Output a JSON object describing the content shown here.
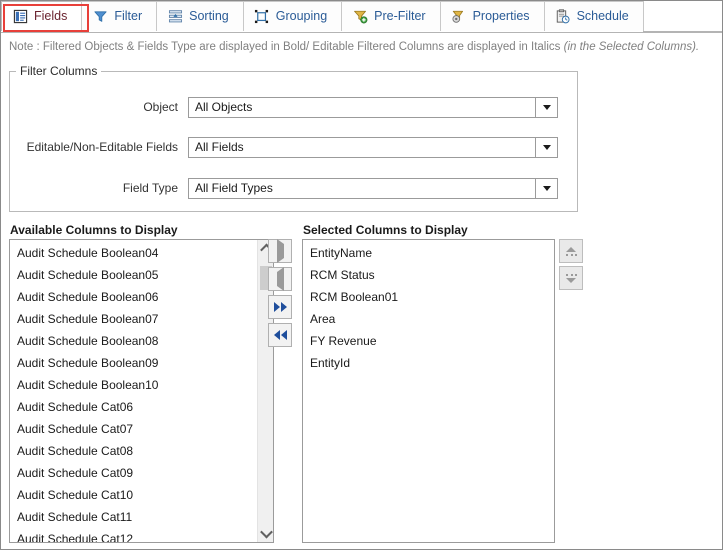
{
  "tabs": [
    {
      "label": "Fields",
      "icon": "fields-icon",
      "active": true
    },
    {
      "label": "Filter",
      "icon": "filter-icon",
      "active": false
    },
    {
      "label": "Sorting",
      "icon": "sorting-icon",
      "active": false
    },
    {
      "label": "Grouping",
      "icon": "grouping-icon",
      "active": false
    },
    {
      "label": "Pre-Filter",
      "icon": "pre-filter-icon",
      "active": false
    },
    {
      "label": "Properties",
      "icon": "properties-icon",
      "active": false
    },
    {
      "label": "Schedule",
      "icon": "schedule-icon",
      "active": false
    }
  ],
  "note": {
    "text": "Note : Filtered Objects & Fields Type are displayed in Bold/ Editable Filtered Columns are displayed in Italics ",
    "italic_text": "(in the Selected Columns)."
  },
  "filter_columns": {
    "title": "Filter Columns",
    "rows": [
      {
        "label": "Object",
        "value": "All Objects"
      },
      {
        "label": "Editable/Non-Editable Fields",
        "value": "All Fields"
      },
      {
        "label": "Field Type",
        "value": "All Field Types"
      }
    ]
  },
  "available": {
    "heading": "Available Columns to Display",
    "items": [
      "Audit Schedule Boolean04",
      "Audit Schedule Boolean05",
      "Audit Schedule Boolean06",
      "Audit Schedule Boolean07",
      "Audit Schedule Boolean08",
      "Audit Schedule Boolean09",
      "Audit Schedule Boolean10",
      "Audit Schedule Cat06",
      "Audit Schedule Cat07",
      "Audit Schedule Cat08",
      "Audit Schedule Cat09",
      "Audit Schedule Cat10",
      "Audit Schedule Cat11",
      "Audit Schedule Cat12"
    ]
  },
  "selected": {
    "heading": "Selected Columns to Display",
    "items": [
      "EntityName",
      "RCM Status",
      "RCM Boolean01",
      "Area",
      "FY Revenue",
      "EntityId"
    ]
  },
  "transfer_buttons": [
    {
      "name": "move-right-button",
      "icon": "caret-right-icon",
      "enabled": false
    },
    {
      "name": "move-left-button",
      "icon": "caret-left-icon",
      "enabled": false
    },
    {
      "name": "move-all-right-button",
      "icon": "double-caret-right-icon",
      "enabled": true
    },
    {
      "name": "move-all-left-button",
      "icon": "double-caret-left-icon",
      "enabled": true
    }
  ],
  "reorder_buttons": [
    {
      "name": "move-up-button",
      "icon": "arrow-up-icon"
    },
    {
      "name": "move-down-button",
      "icon": "arrow-down-icon"
    }
  ],
  "colors": {
    "tab_text": "#2a5b96",
    "active_tab_text": "#6b2430",
    "annotation_red": "#e8403a",
    "note_text": "#808080",
    "enabled_arrow": "#1f4e9c",
    "disabled_arrow": "#9a9a9a"
  }
}
